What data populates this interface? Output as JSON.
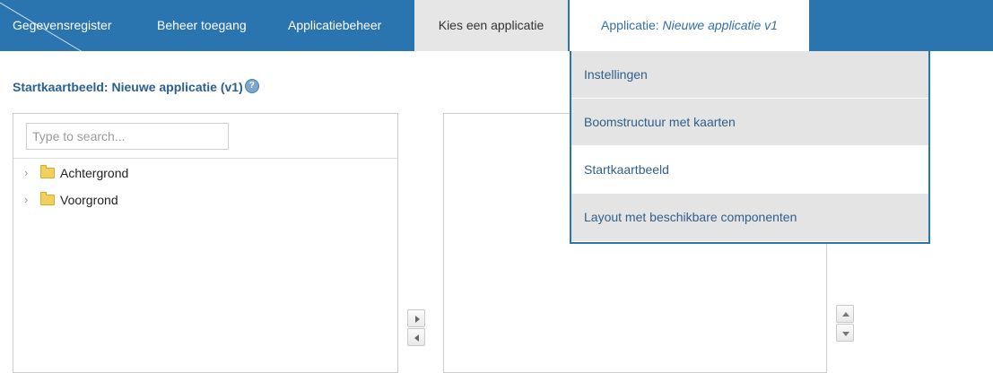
{
  "nav": {
    "items": [
      {
        "label": "Gegevensregister"
      },
      {
        "label": "Beheer toegang"
      },
      {
        "label": "Applicatiebeheer"
      },
      {
        "label": "Kies een applicatie"
      }
    ],
    "active": {
      "prefix": "Applicatie: ",
      "app_name": "Nieuwe applicatie v1"
    }
  },
  "page": {
    "title": "Startkaartbeeld: Nieuwe applicatie (v1)",
    "help_icon": "help-icon"
  },
  "tree": {
    "search_placeholder": "Type to search...",
    "nodes": [
      {
        "label": "Achtergrond",
        "icon": "folder-icon"
      },
      {
        "label": "Voorgrond",
        "icon": "folder-icon"
      }
    ]
  },
  "dropdown": {
    "items": [
      {
        "label": "Instellingen"
      },
      {
        "label": "Boomstructuur met kaarten"
      },
      {
        "label": "Startkaartbeeld"
      },
      {
        "label": "Layout met beschikbare componenten"
      }
    ],
    "selected": "Startkaartbeeld"
  },
  "colors": {
    "nav_bar": "#2a74b0",
    "title_text": "#2b5f8f",
    "menu_text": "#2f5f8a",
    "folder": "#f3cf5e"
  }
}
